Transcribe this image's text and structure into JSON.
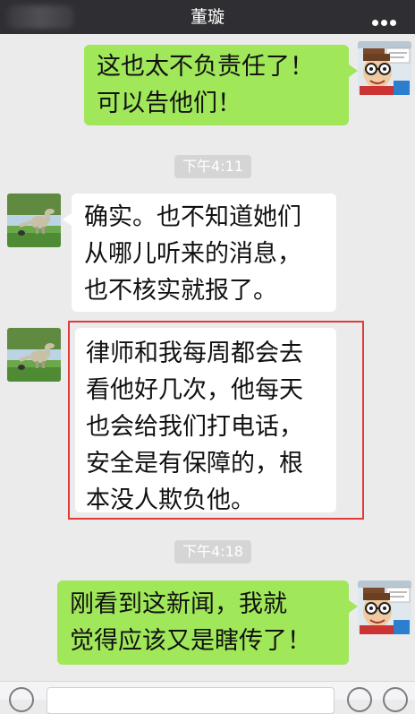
{
  "header": {
    "title": "董璇",
    "back_icon": "blurred-back-icon",
    "more_icon": "more-dots-icon",
    "bg_color": "#2f2f33"
  },
  "messages": [
    {
      "direction": "outgoing",
      "avatar_icon": "cartoon-glasses-avatar-icon",
      "lines": [
        "这也太不负责任了！",
        "可以告他们！"
      ]
    },
    {
      "direction": "incoming",
      "avatar_icon": "dinosaur-photo-avatar-icon",
      "lines": [
        "确实。也不知道她们",
        "从哪儿听来的消息，",
        "也不核实就报了。"
      ]
    },
    {
      "direction": "incoming",
      "avatar_icon": "dinosaur-photo-avatar-icon",
      "highlighted": true,
      "lines": [
        "律师和我每周都会去",
        "看他好几次，他每天",
        "也会给我们打电话，",
        "安全是有保障的，根",
        "本没人欺负他。"
      ]
    },
    {
      "direction": "outgoing",
      "avatar_icon": "cartoon-glasses-avatar-icon",
      "lines": [
        "刚看到这新闻，我就",
        "觉得应该又是瞎传了！"
      ]
    }
  ],
  "timestamps": [
    "下午4:11",
    "下午4:18"
  ],
  "colors": {
    "chat_bg": "#ebebeb",
    "outgoing_bubble": "#a0e75a",
    "incoming_bubble": "#ffffff",
    "highlight_border": "#e03b3b"
  },
  "input_bar": {
    "voice_icon": "voice-icon",
    "emoji_icon": "emoji-icon",
    "plus_icon": "plus-icon"
  }
}
